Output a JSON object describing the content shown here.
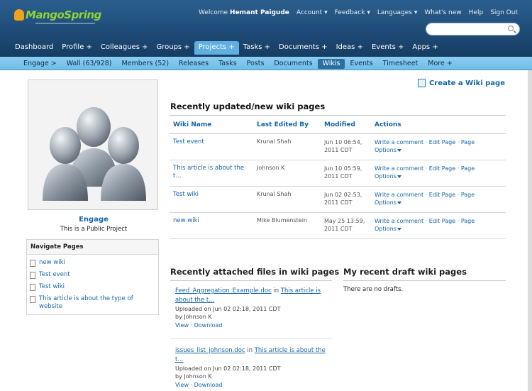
{
  "header": {
    "logo_text": "MangoSpring",
    "welcome_prefix": "Welcome",
    "user_name": "Hemant Paigude",
    "links": [
      "Account",
      "Feedback",
      "Languages",
      "What's new",
      "Help",
      "Sign Out"
    ],
    "search_placeholder": ""
  },
  "main_nav": {
    "tabs": [
      {
        "label": "Dashboard"
      },
      {
        "label": "Profile +"
      },
      {
        "label": "Colleagues +"
      },
      {
        "label": "Groups +"
      },
      {
        "label": "Projects +",
        "active": true
      },
      {
        "label": "Tasks +"
      },
      {
        "label": "Documents +"
      },
      {
        "label": "Ideas +"
      },
      {
        "label": "Events +"
      },
      {
        "label": "Apps +"
      }
    ]
  },
  "sub_nav": {
    "items": [
      {
        "label": "Engage  >"
      },
      {
        "label": "Wall (63/928)"
      },
      {
        "label": "Members (52)"
      },
      {
        "label": "Releases"
      },
      {
        "label": "Tasks"
      },
      {
        "label": "Posts"
      },
      {
        "label": "Documents"
      },
      {
        "label": "Wikis",
        "active": true
      },
      {
        "label": "Events"
      },
      {
        "label": "Timesheet"
      },
      {
        "label": "More +"
      }
    ]
  },
  "project": {
    "name": "Engage",
    "subtitle": "This is a Public Project"
  },
  "navigate_pages": {
    "heading": "Navigate Pages",
    "items": [
      "new wiki",
      "Test event",
      "Test wiki",
      "This article is about the type of website"
    ]
  },
  "create_wiki_label": "Create a Wiki page",
  "recent": {
    "title": "Recently updated/new wiki pages",
    "columns": [
      "Wiki Name",
      "Last Edited By",
      "Modified",
      "Actions"
    ],
    "rows": [
      {
        "name": "Test event",
        "editor": "Krunal Shah",
        "modified": "Jun 10 06:54, 2011 CDT"
      },
      {
        "name": "This article is about the t...",
        "editor": "Johnson K",
        "modified": "Jun 10 05:59, 2011 CDT"
      },
      {
        "name": "Test wiki",
        "editor": "Krunal Shah",
        "modified": "Jun 02 02:53, 2011 CDT"
      },
      {
        "name": "new wiki",
        "editor": "Mike Blumenstein",
        "modified": "May 25 13:59, 2011 CDT"
      }
    ],
    "actions": {
      "comment": "Write a comment",
      "edit": "Edit Page",
      "page": "Page",
      "options": "Options"
    }
  },
  "files": {
    "title": "Recently attached files in wiki pages",
    "items": [
      {
        "file": "Feed_Aggregation_Example.doc",
        "in": "in",
        "page": "This article is about the t...",
        "uploaded": "Uploaded on Jun 02 02:18, 2011 CDT",
        "by": "by Johnson K",
        "view": "View",
        "download": "Download"
      },
      {
        "file": "issues_list_johnson.doc",
        "in": "in",
        "page": "This article is about the t...",
        "uploaded": "Uploaded on Jun 02 02:18, 2011 CDT",
        "by": "by Johnson K",
        "view": "View",
        "download": "Download"
      }
    ]
  },
  "drafts": {
    "title": "My recent draft wiki pages",
    "empty": "There are no drafts."
  }
}
